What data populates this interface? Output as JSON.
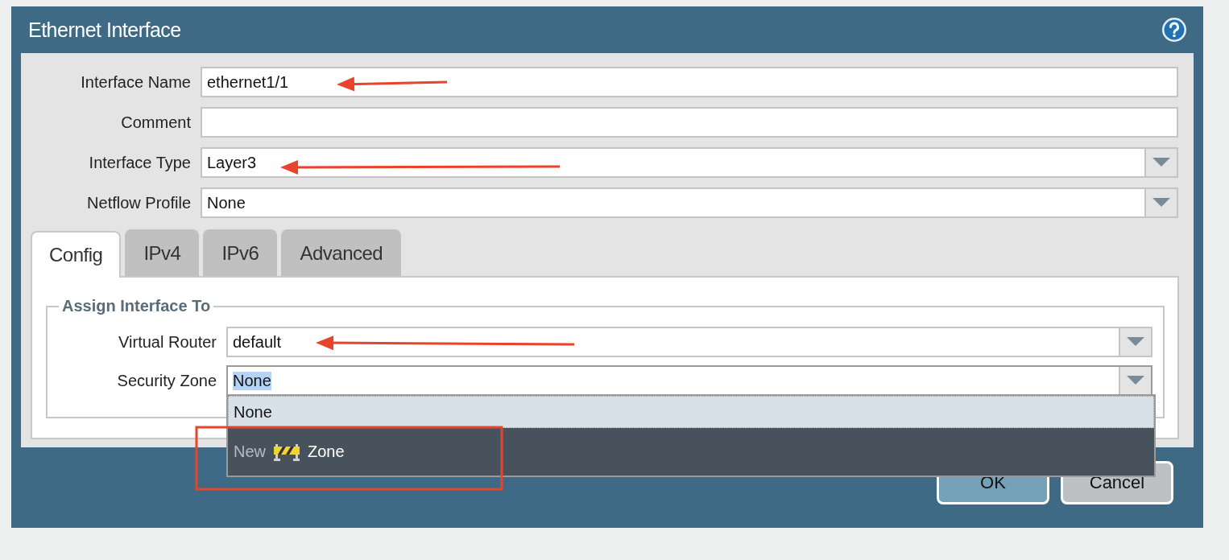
{
  "dialog": {
    "title": "Ethernet Interface",
    "fields": [
      {
        "kind": "text",
        "label": "Interface Name",
        "value": "ethernet1/1"
      },
      {
        "kind": "text",
        "label": "Comment"
      },
      {
        "kind": "select",
        "label": "Interface Type",
        "value": "Layer3"
      },
      {
        "kind": "select",
        "label": "Netflow Profile",
        "value": "None"
      }
    ],
    "tabs": [
      {
        "label": "Config",
        "selected": true
      },
      {
        "label": "IPv4",
        "selected": false
      },
      {
        "label": "IPv6",
        "selected": false
      },
      {
        "label": "Advanced",
        "selected": false
      }
    ],
    "section": {
      "title": "Assign Interface To",
      "fields": [
        {
          "label": "Virtual Router",
          "value": "default",
          "open": false,
          "text_selected": false
        },
        {
          "label": "Security Zone",
          "value": "None",
          "open": true,
          "text_selected": true,
          "options": [
            {
              "kind": "option",
              "label": "None",
              "selected": true
            },
            {
              "kind": "action",
              "prefix": "New",
              "label": "Zone",
              "selected": false
            }
          ]
        }
      ]
    },
    "buttons": [
      {
        "kind": "primary",
        "label": "OK"
      },
      {
        "kind": "secondary",
        "label": "Cancel"
      }
    ]
  }
}
